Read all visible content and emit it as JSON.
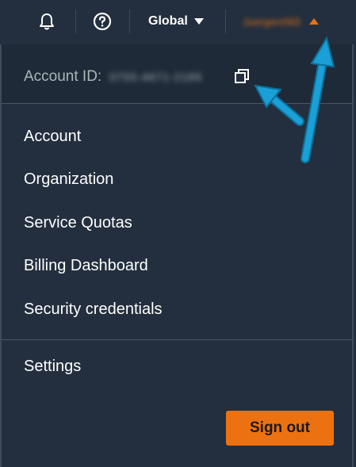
{
  "topbar": {
    "icons": [
      "bell-icon",
      "help-icon"
    ],
    "region_label": "Global",
    "user_name": "Juergen065"
  },
  "account": {
    "id_label": "Account ID:",
    "id_value": "0755-4671-2189",
    "copy_icon": "copy-icon"
  },
  "menu": {
    "items": [
      {
        "label": "Account"
      },
      {
        "label": "Organization"
      },
      {
        "label": "Service Quotas"
      },
      {
        "label": "Billing Dashboard"
      },
      {
        "label": "Security credentials"
      }
    ],
    "settings_label": "Settings",
    "signout_label": "Sign out"
  },
  "colors": {
    "background": "#232f3e",
    "accent": "#ec7211",
    "annotation_arrow": "#1a9fd6",
    "text": "#ffffff",
    "muted_text": "#aab7b8"
  }
}
